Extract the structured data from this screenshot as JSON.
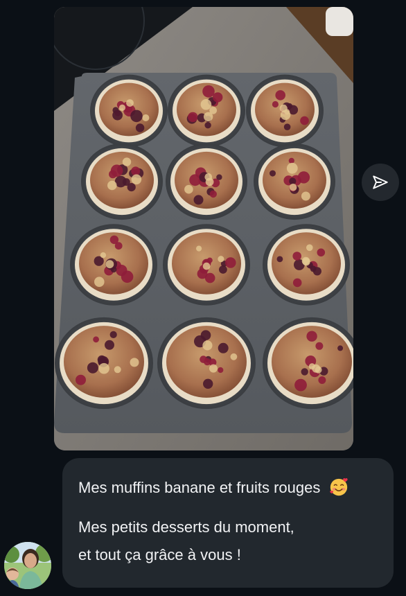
{
  "conversation": {
    "shared_photo": {
      "subject": "muffin-tray-photo",
      "muffin_count": 12
    },
    "share_button": {
      "icon": "send-icon"
    },
    "message": {
      "lines": [
        "Mes muffins banane et fruits rouges",
        "Mes petits desserts du moment,",
        "et tout ça grâce à vous !"
      ],
      "emoji": "smiling-face-with-hearts-icon"
    },
    "sender": {
      "avatar": "avatar"
    }
  },
  "colors": {
    "background": "#0b1016",
    "bubble": "#22282e",
    "text": "#f2f3f5",
    "share_button": "#23282e"
  }
}
